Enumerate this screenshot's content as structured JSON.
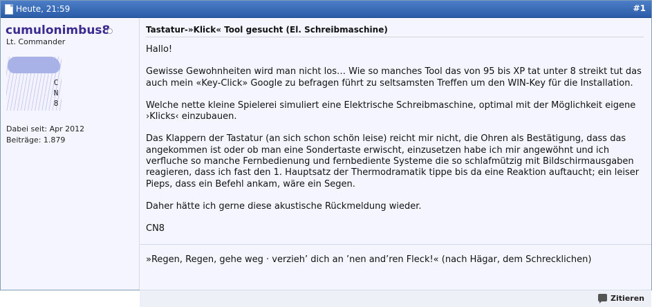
{
  "header": {
    "date": "Heute, 21:59",
    "post_number": "#1"
  },
  "user": {
    "name": "cumulonimbus8",
    "rank": "Lt. Commander",
    "avatar_letters": [
      "C",
      "N",
      "8"
    ],
    "joined": "Dabei seit: Apr 2012",
    "posts": "Beiträge: 1.879"
  },
  "post": {
    "title": "Tastatur-»Klick« Tool gesucht (El. Schreibmaschine)",
    "paragraphs": [
      "Hallo!",
      "Gewisse Gewohnheiten wird man nicht los… Wie so manches Tool das von 95 bis XP tat unter 8 streikt tut das auch mein «Key-Click» Google zu befragen führt zu seltsamsten Treffen um den WIN-Key für die Installation.",
      "Welche nette kleine Spielerei simuliert eine Elektrische Schreibmaschine, optimal mit der Möglichkeit eigene ›Klicks‹ einzubauen.",
      "Das Klappern der Tastatur (an sich schon schön leise) reicht mir nicht, die Ohren als Bestätigung, dass das angekommen ist oder ob man eine Sondertaste erwischt, einzusetzen habe ich mir angewöhnt und ich verfluche so manche Fernbedienung und fernbediente Systeme die so schlafmützig mit Bildschirmausgaben reagieren, dass ich fast den 1. Hauptsatz der Thermodramatik tippe bis da eine Reaktion auftaucht; ein leiser Pieps, dass ein Befehl ankam, wäre ein Segen.",
      "Daher hätte ich gerne diese akustische Rückmeldung wieder.",
      "CN8"
    ],
    "signature": "»Regen, Regen, gehe weg · verzieh’ dich an ’nen and’ren Fleck!« (nach Hägar, dem Schrecklichen)"
  },
  "footer": {
    "quote_label": "Zitieren"
  }
}
